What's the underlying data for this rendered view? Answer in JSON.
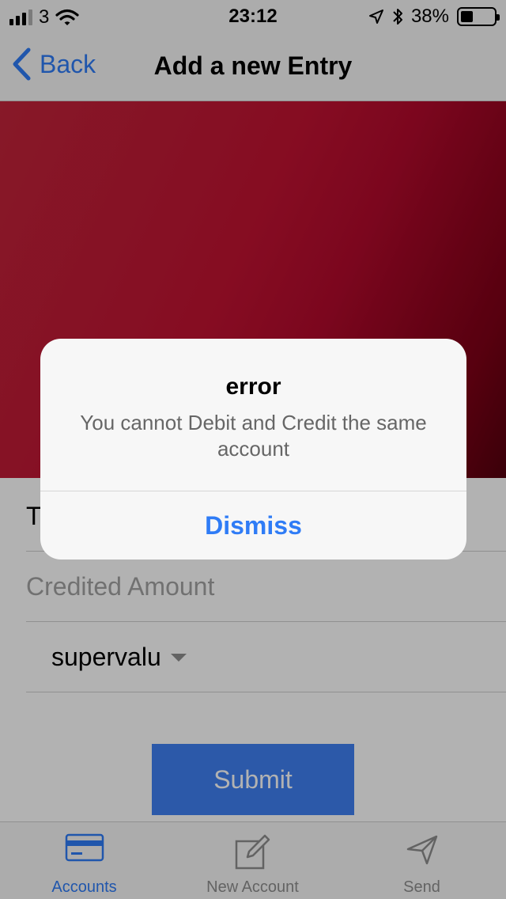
{
  "status_bar": {
    "carrier": "3",
    "time": "23:12",
    "battery_percent": "38%",
    "battery_level": 0.38
  },
  "nav": {
    "back_label": "Back",
    "title": "Add a new Entry"
  },
  "form": {
    "type_field_value": "T",
    "credited_amount_placeholder": "Credited Amount",
    "account_select_value": "supervalu",
    "submit_label": "Submit"
  },
  "tab_bar": {
    "tabs": [
      {
        "label": "Accounts",
        "icon": "credit-card-icon",
        "active": true
      },
      {
        "label": "New Account",
        "icon": "compose-icon",
        "active": false
      },
      {
        "label": "Send",
        "icon": "send-icon",
        "active": false
      }
    ]
  },
  "alert": {
    "title": "error",
    "message": "You cannot Debit and Credit the same account",
    "dismiss_label": "Dismiss"
  },
  "colors": {
    "accent": "#2f7cf6",
    "hero": "#c11332",
    "submit": "#3f80f2"
  }
}
